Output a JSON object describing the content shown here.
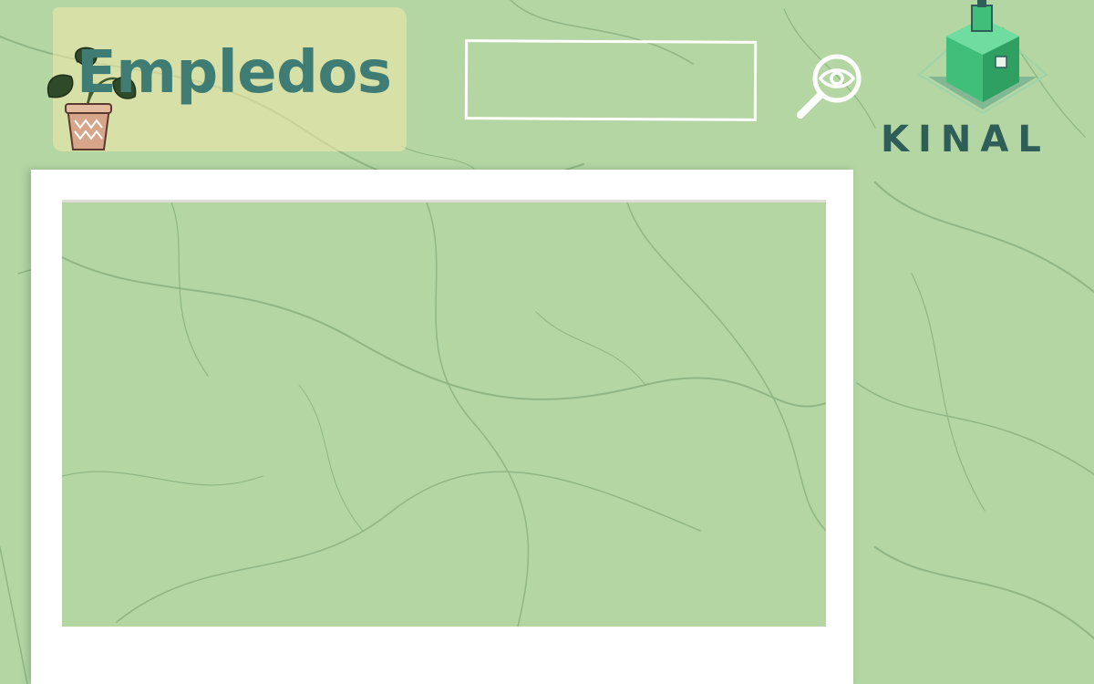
{
  "header": {
    "title": "Empledos",
    "plant_icon": "potted-plant-icon"
  },
  "search": {
    "value": "",
    "placeholder": "",
    "button_icon": "magnifier-eye-icon"
  },
  "logo": {
    "text": "KINAL",
    "icon": "kinal-logo-icon"
  },
  "content": {
    "employees": []
  },
  "colors": {
    "background": "#b3d6a3",
    "title": "#3f7d74",
    "logo_dark": "#2f5d57",
    "logo_green": "#3fbf7a",
    "frame": "#ffffff"
  }
}
